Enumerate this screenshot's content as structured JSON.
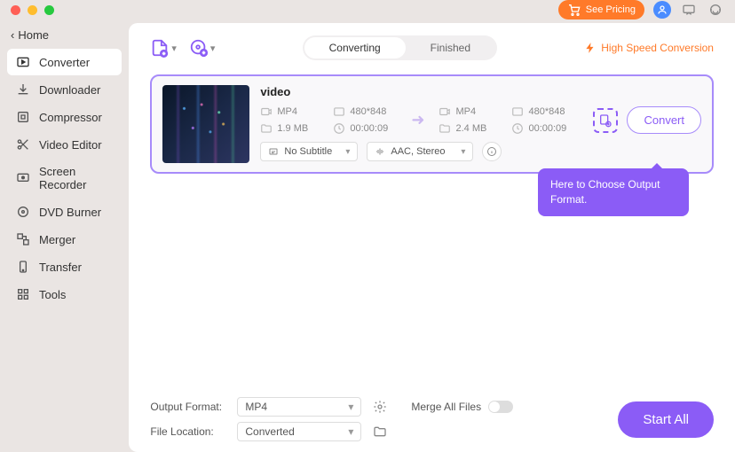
{
  "titlebar": {
    "pricing": "See Pricing"
  },
  "home": "Home",
  "sidebar": [
    {
      "label": "Converter",
      "icon": "converter"
    },
    {
      "label": "Downloader",
      "icon": "download"
    },
    {
      "label": "Compressor",
      "icon": "compress"
    },
    {
      "label": "Video Editor",
      "icon": "scissors"
    },
    {
      "label": "Screen Recorder",
      "icon": "recorder"
    },
    {
      "label": "DVD Burner",
      "icon": "disc"
    },
    {
      "label": "Merger",
      "icon": "merger"
    },
    {
      "label": "Transfer",
      "icon": "transfer"
    },
    {
      "label": "Tools",
      "icon": "tools"
    }
  ],
  "tabs": {
    "converting": "Converting",
    "finished": "Finished"
  },
  "highSpeed": "High Speed Conversion",
  "video": {
    "title": "video",
    "src": {
      "fmt": "MP4",
      "res": "480*848",
      "size": "1.9 MB",
      "dur": "00:00:09"
    },
    "dst": {
      "fmt": "MP4",
      "res": "480*848",
      "size": "2.4 MB",
      "dur": "00:00:09"
    },
    "subtitle": "No Subtitle",
    "audio": "AAC, Stereo",
    "convert": "Convert"
  },
  "tooltip": "Here to Choose Output Format.",
  "footer": {
    "outputFormatLabel": "Output Format:",
    "outputFormat": "MP4",
    "fileLocationLabel": "File Location:",
    "fileLocation": "Converted",
    "merge": "Merge All Files",
    "startAll": "Start All"
  }
}
